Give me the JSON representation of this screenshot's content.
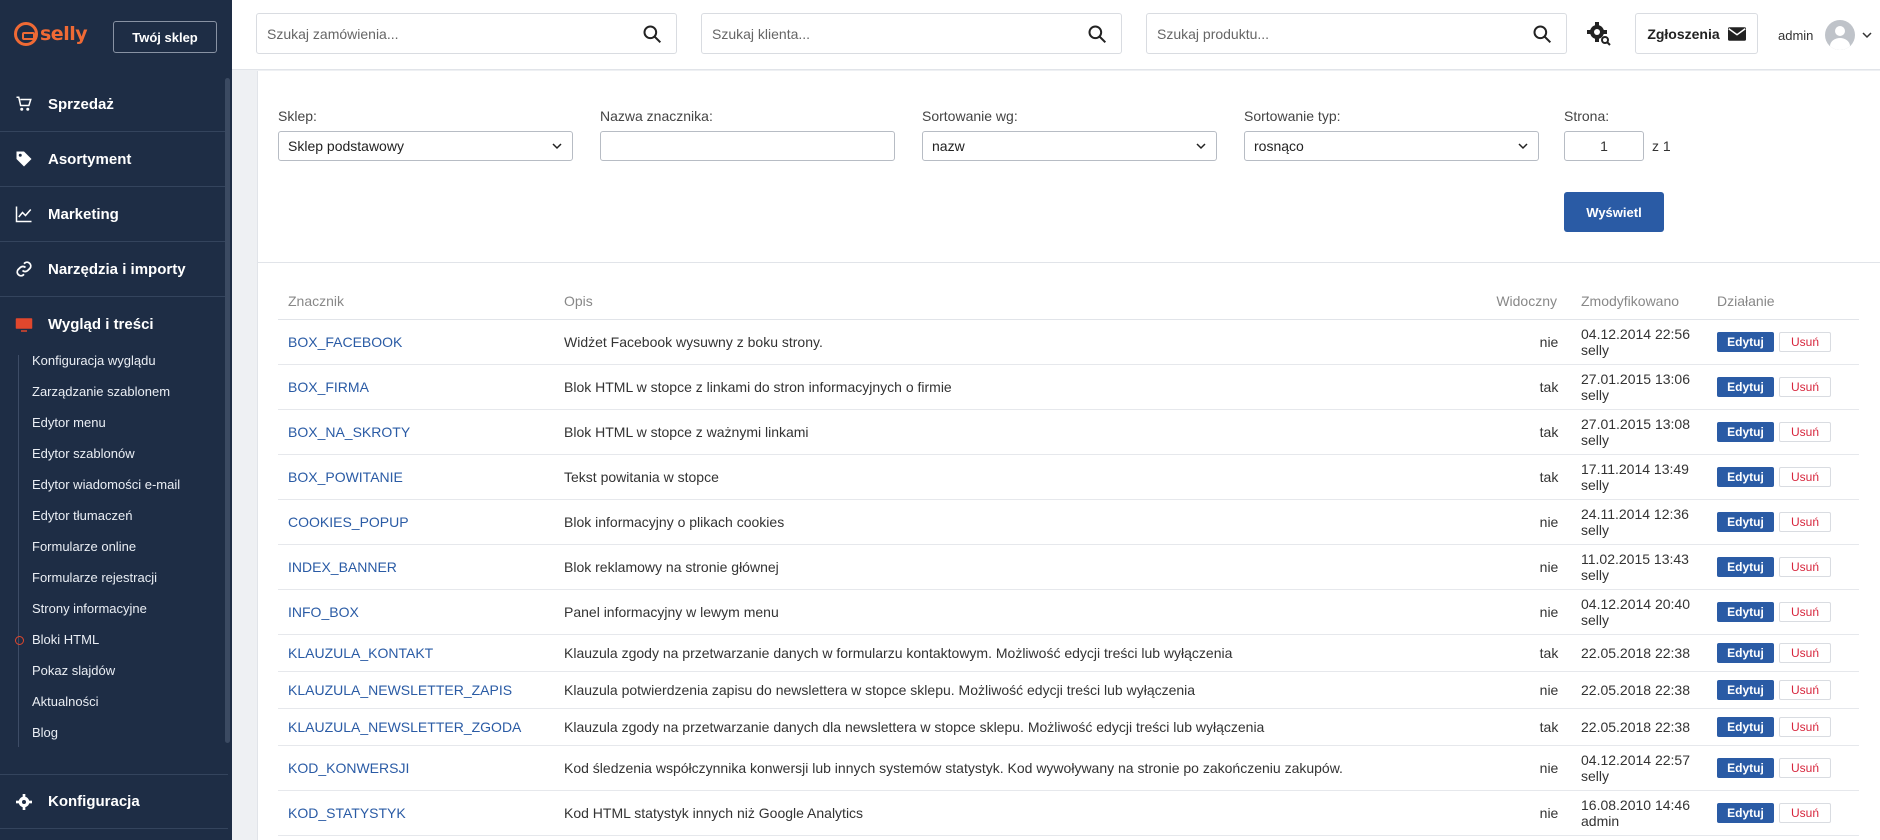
{
  "sidebar": {
    "logo_text": "selly",
    "shop_button": "Twój sklep",
    "sections": [
      {
        "label": "Sprzedaż",
        "icon": "cart-icon"
      },
      {
        "label": "Asortyment",
        "icon": "tag-icon"
      },
      {
        "label": "Marketing",
        "icon": "chart-line-icon"
      },
      {
        "label": "Narzędzia i importy",
        "icon": "link-icon"
      },
      {
        "label": "Wygląd i treści",
        "icon": "monitor-icon"
      }
    ],
    "sub_items": [
      "Konfiguracja wyglądu",
      "Zarządzanie szablonem",
      "Edytor menu",
      "Edytor szablonów",
      "Edytor wiadomości e-mail",
      "Edytor tłumaczeń",
      "Formularze online",
      "Formularze rejestracji",
      "Strony informacyjne",
      "Bloki HTML",
      "Pokaz slajdów",
      "Aktualności",
      "Blog"
    ],
    "active_sub": "Bloki HTML",
    "config_label": "Konfiguracja"
  },
  "header": {
    "search_orders_placeholder": "Szukaj zamówienia...",
    "search_clients_placeholder": "Szukaj klienta...",
    "search_products_placeholder": "Szukaj produktu...",
    "tickets_label": "Zgłoszenia",
    "user_label": "admin"
  },
  "filters": {
    "shop_label": "Sklep:",
    "shop_value": "Sklep podstawowy",
    "tag_label": "Nazwa znacznika:",
    "tag_value": "",
    "sort_label": "Sortowanie wg:",
    "sort_value": "nazw",
    "sort_type_label": "Sortowanie typ:",
    "sort_type_value": "rosnąco",
    "page_label": "Strona:",
    "page_value": "1",
    "page_total": "z 1",
    "show_button": "Wyświetl"
  },
  "table": {
    "headers": [
      "Znacznik",
      "Opis",
      "Widoczny",
      "Zmodyfikowano",
      "Działanie"
    ],
    "edit_label": "Edytuj",
    "delete_label": "Usuń",
    "rows": [
      {
        "tag": "BOX_FACEBOOK",
        "desc": "Widżet Facebook wysuwny z boku strony.",
        "visible": "nie",
        "date": "04.12.2014 22:56",
        "user": "selly"
      },
      {
        "tag": "BOX_FIRMA",
        "desc": "Blok HTML w stopce z linkami do stron informacyjnych o firmie",
        "visible": "tak",
        "date": "27.01.2015 13:06",
        "user": "selly"
      },
      {
        "tag": "BOX_NA_SKROTY",
        "desc": "Blok HTML w stopce z ważnymi linkami",
        "visible": "tak",
        "date": "27.01.2015 13:08",
        "user": "selly"
      },
      {
        "tag": "BOX_POWITANIE",
        "desc": "Tekst powitania w stopce",
        "visible": "tak",
        "date": "17.11.2014 13:49",
        "user": "selly"
      },
      {
        "tag": "COOKIES_POPUP",
        "desc": "Blok informacyjny o plikach cookies",
        "visible": "nie",
        "date": "24.11.2014 12:36",
        "user": "selly"
      },
      {
        "tag": "INDEX_BANNER",
        "desc": "Blok reklamowy na stronie głównej",
        "visible": "nie",
        "date": "11.02.2015 13:43",
        "user": "selly"
      },
      {
        "tag": "INFO_BOX",
        "desc": "Panel informacyjny w lewym menu",
        "visible": "nie",
        "date": "04.12.2014 20:40",
        "user": "selly"
      },
      {
        "tag": "KLAUZULA_KONTAKT",
        "desc": "Klauzula zgody na przetwarzanie danych w formularzu kontaktowym. Możliwość edycji treści lub wyłączenia",
        "visible": "tak",
        "date": "22.05.2018 22:38",
        "user": ""
      },
      {
        "tag": "KLAUZULA_NEWSLETTER_ZAPIS",
        "desc": "Klauzula potwierdzenia zapisu do newslettera w stopce sklepu. Możliwość edycji treści lub wyłączenia",
        "visible": "nie",
        "date": "22.05.2018 22:38",
        "user": ""
      },
      {
        "tag": "KLAUZULA_NEWSLETTER_ZGODA",
        "desc": "Klauzula zgody na przetwarzanie danych dla newslettera w stopce sklepu. Możliwość edycji treści lub wyłączenia",
        "visible": "tak",
        "date": "22.05.2018 22:38",
        "user": ""
      },
      {
        "tag": "KOD_KONWERSJI",
        "desc": "Kod śledzenia współczynnika konwersji lub innych systemów statystyk. Kod wywoływany na stronie po zakończeniu zakupów.",
        "visible": "nie",
        "date": "04.12.2014 22:57",
        "user": "selly"
      },
      {
        "tag": "KOD_STATYSTYK",
        "desc": "Kod HTML statystyk innych niż Google Analytics",
        "visible": "nie",
        "date": "16.08.2010 14:46",
        "user": "admin"
      }
    ]
  },
  "colors": {
    "sidebar_bg": "#1e2d45",
    "accent_blue": "#2a5ba5",
    "brand_orange": "#f06a35",
    "delete_red": "#d7263d"
  }
}
